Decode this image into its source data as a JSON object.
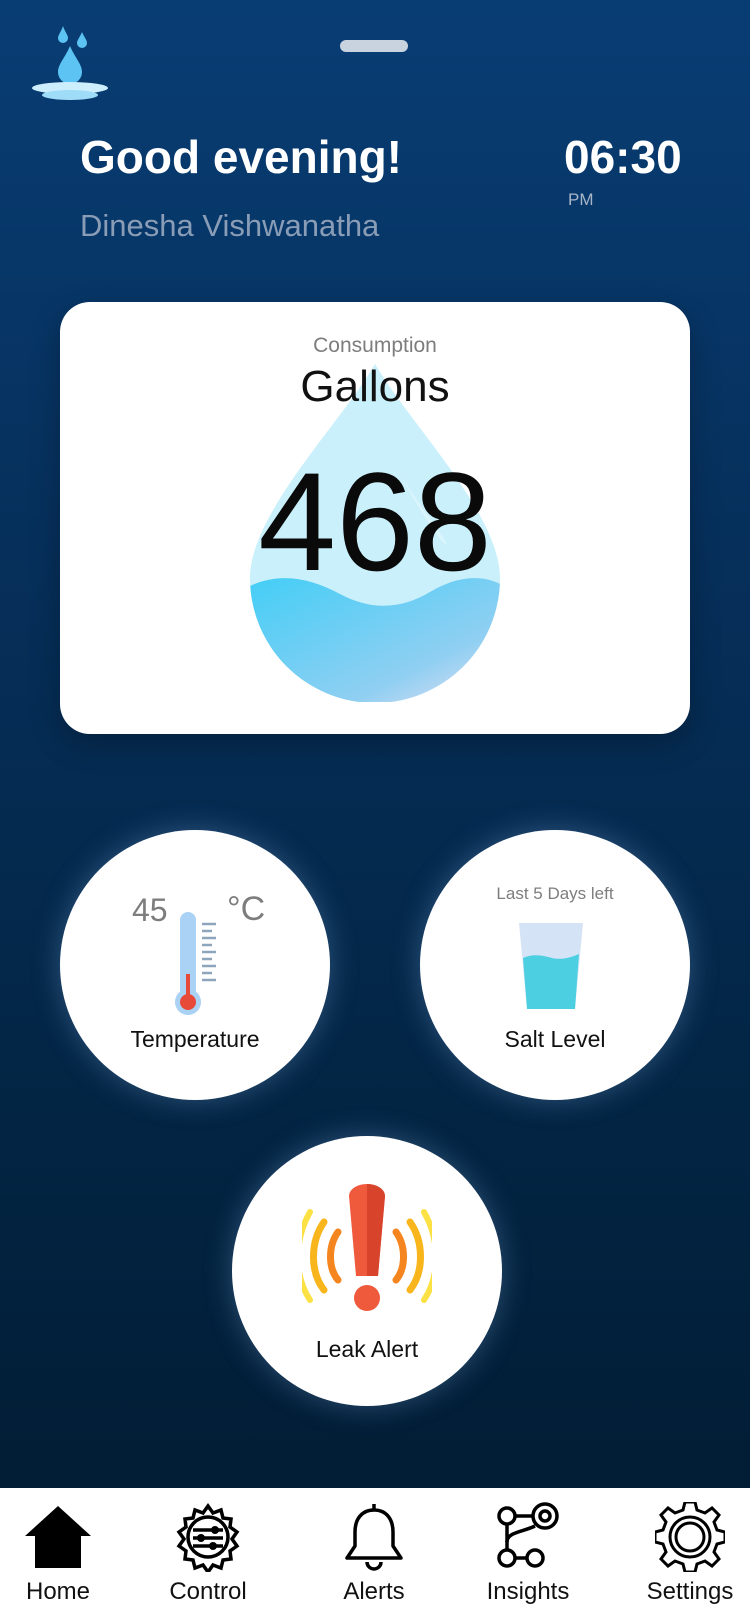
{
  "header": {
    "greeting": "Good evening!",
    "user_name": "Dinesha Vishwanatha",
    "time": "06:30",
    "ampm": "PM",
    "logo_icon": "water-drop-splash-icon"
  },
  "consumption": {
    "label": "Consumption",
    "unit": "Gallons",
    "value": "468",
    "icon": "water-drop-icon"
  },
  "temperature": {
    "value": "45",
    "unit": "°C",
    "label": "Temperature",
    "icon": "thermometer-icon"
  },
  "salt_level": {
    "hint": "Last 5 Days left",
    "label": "Salt Level",
    "icon": "glass-icon"
  },
  "leak_alert": {
    "label": "Leak Alert",
    "icon": "exclamation-alarm-icon"
  },
  "nav": {
    "items": [
      {
        "label": "Home",
        "icon": "home-icon"
      },
      {
        "label": "Control",
        "icon": "control-gear-icon"
      },
      {
        "label": "Alerts",
        "icon": "bell-icon"
      },
      {
        "label": "Insights",
        "icon": "insights-icon"
      },
      {
        "label": "Settings",
        "icon": "gear-icon"
      }
    ]
  },
  "colors": {
    "background_top": "#083d74",
    "background_bottom": "#011a30",
    "card": "#ffffff",
    "water": "#44cef6",
    "alert": "#f05a3c"
  }
}
